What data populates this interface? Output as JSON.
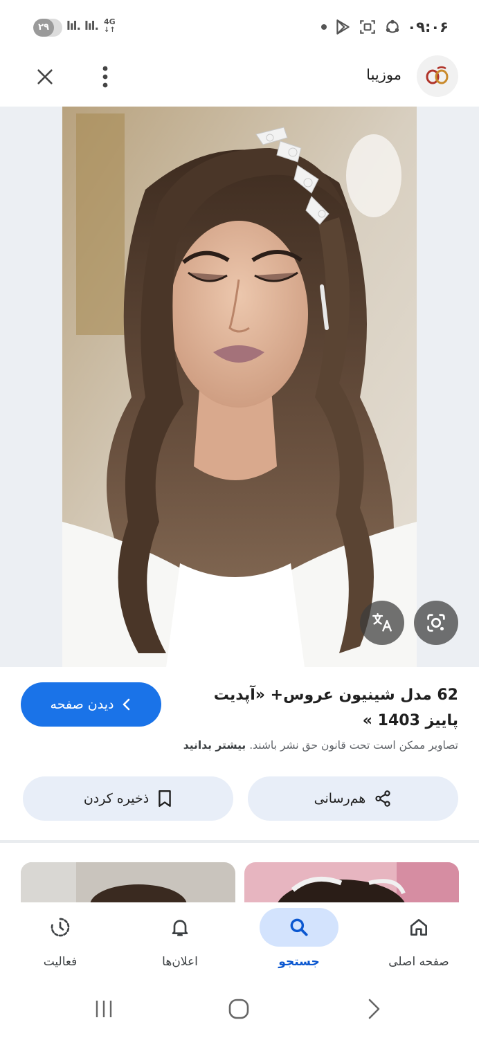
{
  "status_bar": {
    "battery_level": "۲۹",
    "network": "4G",
    "time": "۰۹:۰۶"
  },
  "header": {
    "site_name": "موزیبا"
  },
  "result": {
    "title": "62 مدل شینیون عروس+ «آپدیت پاییز 1403 »",
    "copyright_text": "تصاویر ممکن است تحت قانون حق نشر باشند.",
    "learn_more": "بیشتر بدانید",
    "visit_label": "دیدن صفحه"
  },
  "actions": {
    "share_label": "هم‌رسانی",
    "save_label": "ذخیره کردن"
  },
  "bottom_nav": {
    "items": [
      {
        "label": "صفحه اصلی",
        "icon": "home-icon",
        "active": false
      },
      {
        "label": "جستجو",
        "icon": "search-icon",
        "active": true
      },
      {
        "label": "اعلان‌ها",
        "icon": "bell-icon",
        "active": false
      },
      {
        "label": "فعالیت",
        "icon": "activity-icon",
        "active": false
      }
    ]
  },
  "colors": {
    "accent": "#1a73e8",
    "active_nav": "#0b57d0",
    "pill_bg": "#e8eef8"
  }
}
